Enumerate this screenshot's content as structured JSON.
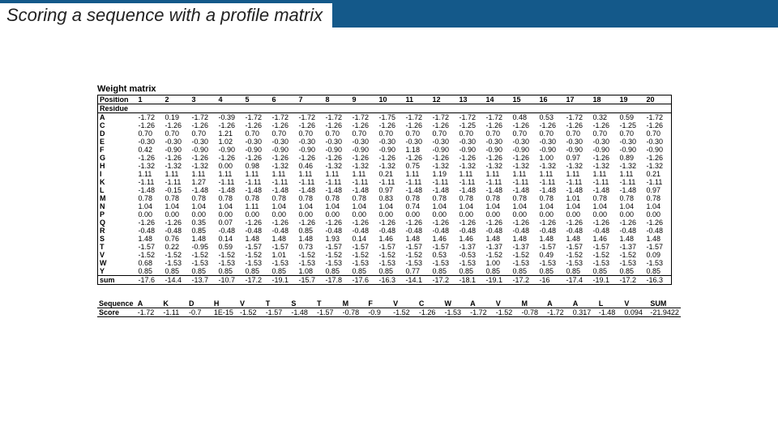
{
  "title": "Scoring a sequence with a profile matrix",
  "matrix_label": "Weight matrix",
  "positions": [
    "1",
    "2",
    "3",
    "4",
    "5",
    "6",
    "7",
    "8",
    "9",
    "10",
    "11",
    "12",
    "13",
    "14",
    "15",
    "16",
    "17",
    "18",
    "19",
    "20"
  ],
  "head_position": "Position",
  "head_residue": "Residue",
  "residues": [
    "A",
    "C",
    "D",
    "E",
    "F",
    "G",
    "H",
    "I",
    "K",
    "L",
    "M",
    "N",
    "P",
    "Q",
    "R",
    "S",
    "T",
    "V",
    "W",
    "Y"
  ],
  "matrix": {
    "A": [
      "-1.72",
      "0.19",
      "-1.72",
      "-0.39",
      "-1.72",
      "-1.72",
      "-1.72",
      "-1.72",
      "-1.72",
      "-1.75",
      "-1.72",
      "-1.72",
      "-1.72",
      "-1.72",
      "0.48",
      "0.53",
      "-1.72",
      "0.32",
      "0.59",
      "-1.72"
    ],
    "C": [
      "-1.26",
      "-1.26",
      "-1.26",
      "-1.26",
      "-1.26",
      "-1.26",
      "-1.26",
      "-1.26",
      "-1.26",
      "-1.26",
      "-1.26",
      "-1.26",
      "-1.25",
      "-1.26",
      "-1.26",
      "-1.26",
      "-1.26",
      "-1.26",
      "-1.25",
      "-1.26"
    ],
    "D": [
      "0.70",
      "0.70",
      "0.70",
      "1.21",
      "0.70",
      "0.70",
      "0.70",
      "0.70",
      "0.70",
      "0.70",
      "0.70",
      "0.70",
      "0.70",
      "0.70",
      "0.70",
      "0.70",
      "0.70",
      "0.70",
      "0.70",
      "0.70"
    ],
    "E": [
      "-0.30",
      "-0.30",
      "-0.30",
      "1.02",
      "-0.30",
      "-0.30",
      "-0.30",
      "-0.30",
      "-0.30",
      "-0.30",
      "-0.30",
      "-0.30",
      "-0.30",
      "-0.30",
      "-0.30",
      "-0.30",
      "-0.30",
      "-0.30",
      "-0.30",
      "-0.30"
    ],
    "F": [
      "0.42",
      "-0.90",
      "-0.90",
      "-0.90",
      "-0.90",
      "-0.90",
      "-0.90",
      "-0.90",
      "-0.90",
      "-0.90",
      "1.18",
      "-0.90",
      "-0.90",
      "-0.90",
      "-0.90",
      "-0.90",
      "-0.90",
      "-0.90",
      "-0.90",
      "-0.90"
    ],
    "G": [
      "-1.26",
      "-1.26",
      "-1.26",
      "-1.26",
      "-1.26",
      "-1.26",
      "-1.26",
      "-1.26",
      "-1.26",
      "-1.26",
      "-1.26",
      "-1.26",
      "-1.26",
      "-1.26",
      "-1.26",
      "1.00",
      "0.97",
      "-1.26",
      "0.89",
      "-1.26"
    ],
    "H": [
      "-1.32",
      "-1.32",
      "-1.32",
      "0.00",
      "0.98",
      "-1.32",
      "0.46",
      "-1.32",
      "-1.32",
      "-1.32",
      "0.75",
      "-1.32",
      "-1.32",
      "-1.32",
      "-1.32",
      "-1.32",
      "-1.32",
      "-1.32",
      "-1.32",
      "-1.32"
    ],
    "I": [
      "1.11",
      "1.11",
      "1.11",
      "1.11",
      "1.11",
      "1.11",
      "1.11",
      "1.11",
      "1.11",
      "0.21",
      "1.11",
      "1.19",
      "1.11",
      "1.11",
      "1.11",
      "1.11",
      "1.11",
      "1.11",
      "1.11",
      "0.21"
    ],
    "K": [
      "-1.11",
      "-1.11",
      "1.27",
      "-1.11",
      "-1.11",
      "-1.11",
      "-1.11",
      "-1.11",
      "-1.11",
      "-1.11",
      "-1.11",
      "-1.11",
      "-1.11",
      "-1.11",
      "-1.11",
      "-1.11",
      "-1.11",
      "-1.11",
      "-1.11",
      "-1.11"
    ],
    "L": [
      "-1.48",
      "-0.15",
      "-1.48",
      "-1.48",
      "-1.48",
      "-1.48",
      "-1.48",
      "-1.48",
      "-1.48",
      "0.97",
      "-1.48",
      "-1.48",
      "-1.48",
      "-1.48",
      "-1.48",
      "-1.48",
      "-1.48",
      "-1.48",
      "-1.48",
      "0.97"
    ],
    "M": [
      "0.78",
      "0.78",
      "0.78",
      "0.78",
      "0.78",
      "0.78",
      "0.78",
      "0.78",
      "0.78",
      "0.83",
      "0.78",
      "0.78",
      "0.78",
      "0.78",
      "0.78",
      "0.78",
      "1.01",
      "0.78",
      "0.78",
      "0.78"
    ],
    "N": [
      "1.04",
      "1.04",
      "1.04",
      "1.04",
      "1.11",
      "1.04",
      "1.04",
      "1.04",
      "1.04",
      "1.04",
      "0.74",
      "1.04",
      "1.04",
      "1.04",
      "1.04",
      "1.04",
      "1.04",
      "1.04",
      "1.04",
      "1.04"
    ],
    "P": [
      "0.00",
      "0.00",
      "0.00",
      "0.00",
      "0.00",
      "0.00",
      "0.00",
      "0.00",
      "0.00",
      "0.00",
      "0.00",
      "0.00",
      "0.00",
      "0.00",
      "0.00",
      "0.00",
      "0.00",
      "0.00",
      "0.00",
      "0.00"
    ],
    "Q": [
      "-1.26",
      "-1.26",
      "0.35",
      "0.07",
      "-1.26",
      "-1.26",
      "-1.26",
      "-1.26",
      "-1.26",
      "-1.26",
      "-1.26",
      "-1.26",
      "-1.26",
      "-1.26",
      "-1.26",
      "-1.26",
      "-1.26",
      "-1.26",
      "-1.26",
      "-1.26"
    ],
    "R": [
      "-0.48",
      "-0.48",
      "0.85",
      "-0.48",
      "-0.48",
      "-0.48",
      "0.85",
      "-0.48",
      "-0.48",
      "-0.48",
      "-0.48",
      "-0.48",
      "-0.48",
      "-0.48",
      "-0.48",
      "-0.48",
      "-0.48",
      "-0.48",
      "-0.48",
      "-0.48"
    ],
    "S": [
      "1.48",
      "0.76",
      "1.48",
      "0.14",
      "1.48",
      "1.48",
      "1.48",
      "1.93",
      "0.14",
      "1.46",
      "1.48",
      "1.46",
      "1.46",
      "1.48",
      "1.48",
      "1.48",
      "1.48",
      "1.46",
      "1.48",
      "1.48"
    ],
    "T": [
      "-1.57",
      "0.22",
      "-0.95",
      "0.59",
      "-1.57",
      "-1.57",
      "0.73",
      "-1.57",
      "-1.57",
      "-1.57",
      "-1.57",
      "-1.57",
      "-1.37",
      "-1.37",
      "-1.37",
      "-1.57",
      "-1.57",
      "-1.57",
      "-1.37",
      "-1.57"
    ],
    "V": [
      "-1.52",
      "-1.52",
      "-1.52",
      "-1.52",
      "-1.52",
      "1.01",
      "-1.52",
      "-1.52",
      "-1.52",
      "-1.52",
      "-1.52",
      "0.53",
      "-0.53",
      "-1.52",
      "-1.52",
      "0.49",
      "-1.52",
      "-1.52",
      "-1.52",
      "0.09"
    ],
    "W": [
      "0.68",
      "-1.53",
      "-1.53",
      "-1.53",
      "-1.53",
      "-1.53",
      "-1.53",
      "-1.53",
      "-1.53",
      "-1.53",
      "-1.53",
      "-1.53",
      "-1.53",
      "1.00",
      "-1.53",
      "-1.53",
      "-1.53",
      "-1.53",
      "-1.53",
      "-1.53"
    ],
    "Y": [
      "0.85",
      "0.85",
      "0.85",
      "0.85",
      "0.85",
      "0.85",
      "1.08",
      "0.85",
      "0.85",
      "0.85",
      "0.77",
      "0.85",
      "0.85",
      "0.85",
      "0.85",
      "0.85",
      "0.85",
      "0.85",
      "0.85",
      "0.85"
    ]
  },
  "bold_cells": [
    [
      0,
      0
    ],
    [
      0,
      1
    ],
    [
      0,
      14
    ],
    [
      0,
      15
    ],
    [
      0,
      17
    ],
    [
      0,
      18
    ],
    [
      2,
      3
    ],
    [
      3,
      3
    ],
    [
      4,
      0
    ],
    [
      4,
      10
    ],
    [
      5,
      15
    ],
    [
      5,
      16
    ],
    [
      5,
      18
    ],
    [
      6,
      3
    ],
    [
      6,
      4
    ],
    [
      6,
      6
    ],
    [
      6,
      10
    ],
    [
      8,
      2
    ],
    [
      9,
      1
    ],
    [
      9,
      9
    ],
    [
      9,
      19
    ],
    [
      10,
      9
    ],
    [
      10,
      16
    ],
    [
      11,
      4
    ],
    [
      11,
      10
    ],
    [
      13,
      2
    ],
    [
      13,
      3
    ],
    [
      14,
      2
    ],
    [
      14,
      6
    ],
    [
      15,
      1
    ],
    [
      15,
      3
    ],
    [
      15,
      7
    ],
    [
      15,
      8
    ],
    [
      15,
      9
    ],
    [
      16,
      1
    ],
    [
      16,
      2
    ],
    [
      16,
      3
    ],
    [
      16,
      6
    ],
    [
      17,
      5
    ],
    [
      17,
      11
    ],
    [
      17,
      12
    ],
    [
      17,
      15
    ],
    [
      17,
      19
    ],
    [
      18,
      0
    ],
    [
      18,
      13
    ],
    [
      19,
      6
    ],
    [
      19,
      10
    ]
  ],
  "sum_label": "sum",
  "sum_row": [
    "-17.6",
    "-14.4",
    "-13.7",
    "-10.7",
    "-17.2",
    "-19.1",
    "-15.7",
    "-17.8",
    "-17.6",
    "-16.3",
    "-14.1",
    "-17.2",
    "-18.1",
    "-19.1",
    "-17.2",
    "-16",
    "-17.4",
    "-19.1",
    "-17.2",
    "-16.3"
  ],
  "seq_label": "Sequence",
  "score_label": "Score",
  "sum_col_label": "SUM",
  "sequence": [
    "A",
    "K",
    "D",
    "H",
    "V",
    "T",
    "S",
    "T",
    "M",
    "F",
    "V",
    "C",
    "W",
    "A",
    "V",
    "M",
    "A",
    "A",
    "L",
    "V"
  ],
  "scores": [
    "-1.72",
    "-1.11",
    "-0.7",
    "1E-15",
    "-1.52",
    "-1.57",
    "-1.48",
    "-1.57",
    "-0.78",
    "-0.9",
    "-1.52",
    "-1.26",
    "-1.53",
    "-1.72",
    "-1.52",
    "-0.78",
    "-1.72",
    "0.317",
    "-1.48",
    "0.094"
  ],
  "score_sum": "-21.9422"
}
